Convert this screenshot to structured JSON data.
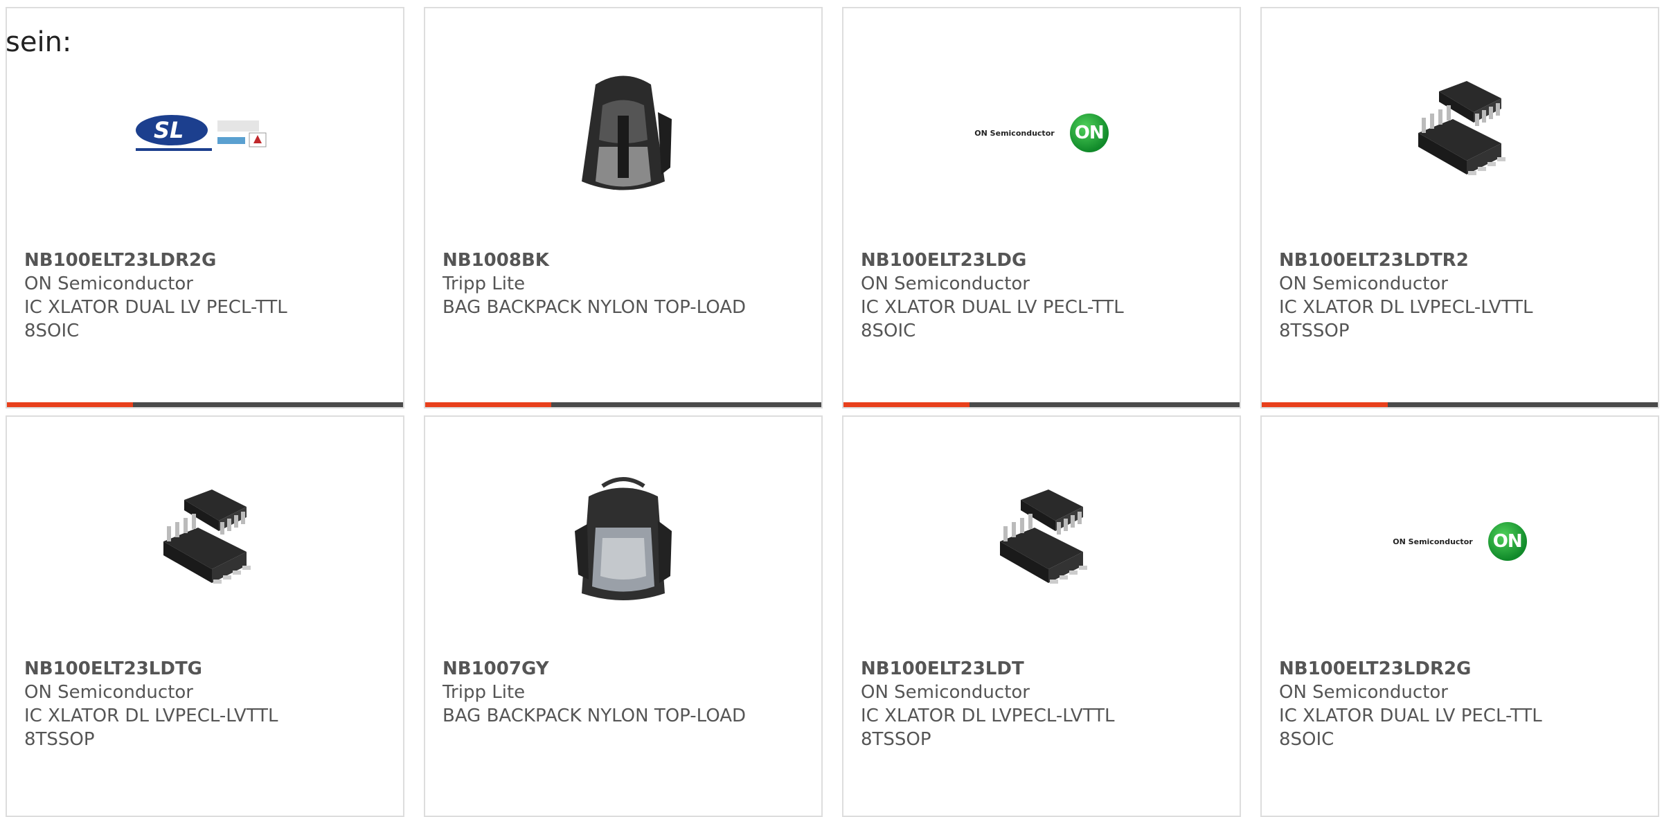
{
  "intro_text": "sein:",
  "cards": [
    {
      "part": "NB100ELT23LDR2G",
      "manufacturer": "ON Semiconductor",
      "description": "IC XLATOR DUAL LV PECL-TTL 8SOIC",
      "image": "sl-power-logo",
      "logo_text": "SL"
    },
    {
      "part": "NB1008BK",
      "manufacturer": "Tripp Lite",
      "description": "BAG BACKPACK NYLON TOP-LOAD",
      "image": "backpack-black"
    },
    {
      "part": "NB100ELT23LDG",
      "manufacturer": "ON Semiconductor",
      "description": "IC XLATOR DUAL LV PECL-TTL 8SOIC",
      "image": "on-semi-logo",
      "logo_text": "ON Semiconductor",
      "logo_badge": "ON"
    },
    {
      "part": "NB100ELT23LDTR2",
      "manufacturer": "ON Semiconductor",
      "description": "IC XLATOR DL LVPECL-LVTTL 8TSSOP",
      "image": "ic-chip"
    },
    {
      "part": "NB100ELT23LDTG",
      "manufacturer": "ON Semiconductor",
      "description": "IC XLATOR DL LVPECL-LVTTL 8TSSOP",
      "image": "ic-chip"
    },
    {
      "part": "NB1007GY",
      "manufacturer": "Tripp Lite",
      "description": "BAG BACKPACK NYLON TOP-LOAD",
      "image": "backpack-gray"
    },
    {
      "part": "NB100ELT23LDT",
      "manufacturer": "ON Semiconductor",
      "description": "IC XLATOR DL LVPECL-LVTTL 8TSSOP",
      "image": "ic-chip"
    },
    {
      "part": "NB100ELT23LDR2G",
      "manufacturer": "ON Semiconductor",
      "description": "IC XLATOR DUAL LV PECL-TTL 8SOIC",
      "image": "on-semi-logo",
      "logo_text": "ON Semiconductor",
      "logo_badge": "ON"
    }
  ],
  "colors": {
    "accent": "#e8401c",
    "bar": "#4a4a4a",
    "border": "#dddddd",
    "text": "#555555"
  }
}
